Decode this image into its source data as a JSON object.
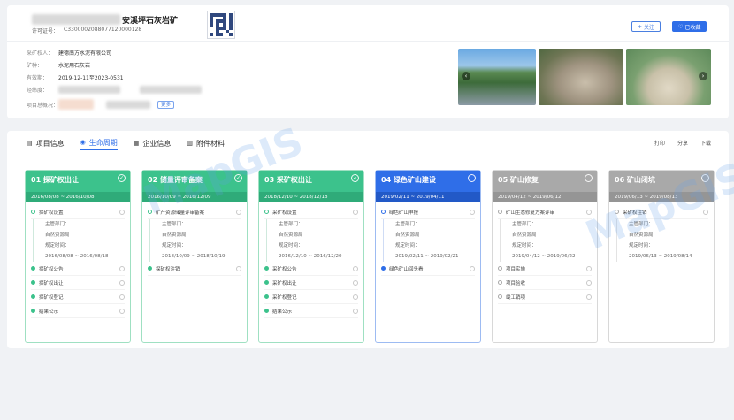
{
  "header": {
    "mine_name": "安溪坪石灰岩矿",
    "permit_label": "许可证号：",
    "permit_no": "C3300002088077120000128",
    "follow_label": "关注",
    "saved_label": "已收藏"
  },
  "info": {
    "owner_label": "采矿权人：",
    "owner_value": "建德南方水泥有限公司",
    "mineral_label": "矿种：",
    "mineral_value": "水泥用石灰岩",
    "validity_label": "有效期：",
    "validity_value": "2019-12-11至2023-0531",
    "coords_label": "经纬度：",
    "contact_label": "项目总概况：",
    "more_label": "更多"
  },
  "tabs": [
    {
      "label": "项目信息",
      "icon": "document-icon"
    },
    {
      "label": "生命周期",
      "icon": "cycle-icon"
    },
    {
      "label": "企业信息",
      "icon": "building-icon"
    },
    {
      "label": "附件材料",
      "icon": "folder-icon"
    }
  ],
  "actions": {
    "print": "打印",
    "share": "分享",
    "download": "下载"
  },
  "stages": [
    {
      "title": "01 探矿权出让",
      "dates": "2016/08/08 ~ 2016/10/08",
      "color": "#3cc28c",
      "tasks": [
        {
          "name": "探矿权设置",
          "detail": {
            "dept_label": "主管部门：",
            "dept": "自然资源局",
            "time_label": "规定时间：",
            "time": "2016/08/08 ~ 2016/08/18"
          }
        },
        {
          "name": "探矿权公告"
        },
        {
          "name": "探矿权出让"
        },
        {
          "name": "探矿权登记"
        },
        {
          "name": "结果公示"
        }
      ]
    },
    {
      "title": "02 储量评审备案",
      "dates": "2016/10/09 ~ 2016/12/09",
      "color": "#3cc28c",
      "tasks": [
        {
          "name": "矿产资源储量评审备案",
          "detail": {
            "dept_label": "主管部门：",
            "dept": "自然资源局",
            "time_label": "规定时间：",
            "time": "2018/10/09 ~ 2018/10/19"
          }
        },
        {
          "name": "探矿权注销"
        }
      ]
    },
    {
      "title": "03 采矿权出让",
      "dates": "2018/12/10 ~ 2018/12/18",
      "color": "#3cc28c",
      "tasks": [
        {
          "name": "采矿权设置",
          "detail": {
            "dept_label": "主管部门：",
            "dept": "自然资源局",
            "time_label": "规定时间：",
            "time": "2016/12/10 ~ 2016/12/20"
          }
        },
        {
          "name": "采矿权公告"
        },
        {
          "name": "采矿权出让"
        },
        {
          "name": "采矿权登记"
        },
        {
          "name": "结果公示"
        }
      ]
    },
    {
      "title": "04 绿色矿山建设",
      "dates": "2019/02/11 ~ 2019/04/11",
      "color": "#2f6ee8",
      "tasks": [
        {
          "name": "绿色矿山申报",
          "detail": {
            "dept_label": "主管部门：",
            "dept": "自然资源局",
            "time_label": "规定时间：",
            "time": "2019/02/11 ~ 2019/02/21"
          }
        },
        {
          "name": "绿色矿山回头看"
        }
      ]
    },
    {
      "title": "05 矿山修复",
      "dates": "2019/04/12 ~ 2019/06/12",
      "color": "#a9a9a9",
      "tasks": [
        {
          "name": "矿山生态修复方案评审",
          "detail": {
            "dept_label": "主管部门：",
            "dept": "自然资源局",
            "time_label": "规定时间：",
            "time": "2019/04/12 ~ 2019/06/22"
          }
        },
        {
          "name": "项目实施"
        },
        {
          "name": "项目验收"
        },
        {
          "name": "竣工销项"
        }
      ]
    },
    {
      "title": "06 矿山闭坑",
      "dates": "2019/06/13 ~ 2019/08/13",
      "color": "#a9a9a9",
      "tasks": [
        {
          "name": "采矿权注销",
          "detail": {
            "dept_label": "主管部门：",
            "dept": "自然资源局",
            "time_label": "规定时间：",
            "time": "2019/06/13 ~ 2019/08/14"
          }
        }
      ]
    }
  ],
  "watermark_text": "MapGIS"
}
